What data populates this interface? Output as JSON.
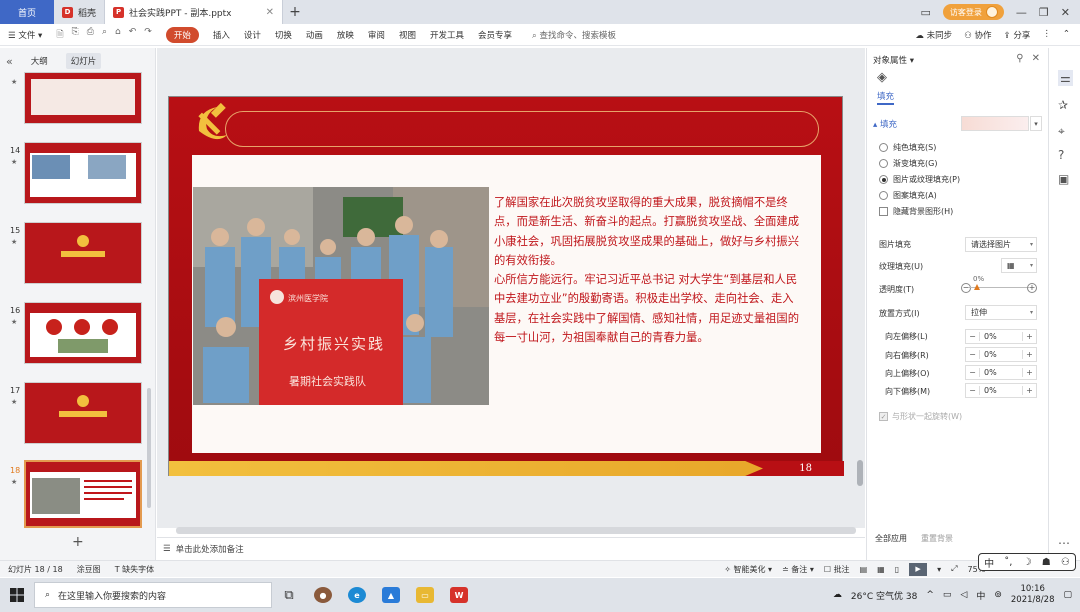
{
  "tabbar": {
    "home": "首页",
    "tabs": [
      {
        "label": "稻壳",
        "logo_color": "#d6322a"
      },
      {
        "label": "社会实践PPT - 副本.pptx",
        "logo_color": "#d6322a"
      }
    ],
    "add": "+",
    "visitor_label": "访客登录"
  },
  "menubar": {
    "file": "文件",
    "start": "开始",
    "items": [
      "插入",
      "设计",
      "切换",
      "动画",
      "放映",
      "审阅",
      "视图",
      "开发工具",
      "会员专享"
    ],
    "search": "查找命令、搜索模板",
    "sync": "未同步",
    "collab": "协作",
    "share": "分享"
  },
  "leftpanel": {
    "tab_outline": "大纲",
    "tab_slides": "幻灯片",
    "slide_numbers": [
      "14",
      "15",
      "16",
      "17",
      "18"
    ],
    "add": "+"
  },
  "slide": {
    "number": "18",
    "paragraph1": "了解国家在此次脱贫攻坚取得的重大成果，脱贫摘帽不是终点，而是新生活、新奋斗的起点。打赢脱贫攻坚战、全面建成小康社会，巩固拓展脱贫攻坚成果的基础上，做好与乡村振兴的有效衔接。",
    "paragraph2": "心所信方能远行。牢记习近平总书记 对大学生“到基层和人民中去建功立业”的殷勤寄语。积极走出学校、走向社会、走入基层，在社会实践中了解国情、感知社情，用足迹丈量祖国的每一寸山河，为祖国奉献自己的青春力量。",
    "banner_line1": "乡村振兴实践",
    "banner_line2": "暑期社会实践队",
    "banner_school": "滨州医学院"
  },
  "notes_placeholder": "单击此处添加备注",
  "rightpanel": {
    "title": "对象属性",
    "tab_fill": "填充",
    "section_fill": "填充",
    "options": [
      {
        "label": "纯色填充(S)",
        "checked": false
      },
      {
        "label": "渐变填充(G)",
        "checked": false
      },
      {
        "label": "图片或纹理填充(P)",
        "checked": true
      },
      {
        "label": "图案填充(A)",
        "checked": false
      }
    ],
    "hide_bg": "隐藏背景图形(H)",
    "picture_fill_label": "图片填充",
    "picture_fill_value": "请选择图片",
    "texture_label": "纹理填充(U)",
    "transparency_label": "透明度(T)",
    "transparency_value": "0%",
    "placement_label": "放置方式(I)",
    "placement_value": "拉伸",
    "offsets": [
      {
        "label": "向左偏移(L)",
        "value": "0%"
      },
      {
        "label": "向右偏移(R)",
        "value": "0%"
      },
      {
        "label": "向上偏移(O)",
        "value": "0%"
      },
      {
        "label": "向下偏移(M)",
        "value": "0%"
      }
    ],
    "rotate_with_shape": "与形状一起旋转(W)",
    "apply_all": "全部应用",
    "reset_bg": "重置背景"
  },
  "statusbar": {
    "slide_info": "幻灯片 18 / 18",
    "theme": "涂豆图",
    "missing_font": "缺失字体",
    "beautify": "智能美化",
    "notes": "备注",
    "comments": "批注",
    "zoom": "75%"
  },
  "ime": {
    "mode": "中"
  },
  "taskbar": {
    "search_placeholder": "在这里输入你要搜索的内容",
    "weather": "26°C 空气优 38",
    "ime": "中",
    "time": "10:16",
    "date": "2021/8/28"
  },
  "colors": {
    "accent": "#3f68c6",
    "start_button": "#d14b2d",
    "slide_red": "#b80f14",
    "slide_text": "#c0161b",
    "gold": "#f2c03e"
  }
}
